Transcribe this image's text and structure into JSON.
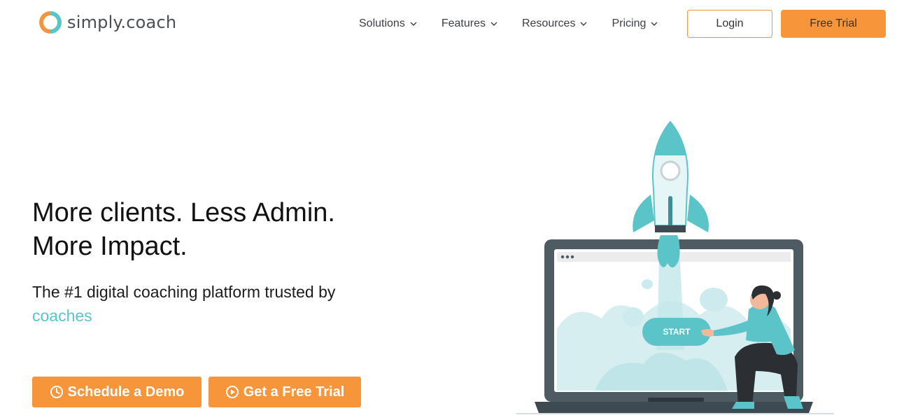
{
  "brand": {
    "name": "simply.coach",
    "accent": "#f7953b",
    "teal": "#5bc4c9",
    "logo_icon": "simply-coach-logo-icon"
  },
  "nav": {
    "items": [
      {
        "label": "Solutions",
        "icon": "chevron-down-icon"
      },
      {
        "label": "Features",
        "icon": "chevron-down-icon"
      },
      {
        "label": "Resources",
        "icon": "chevron-down-icon"
      },
      {
        "label": "Pricing",
        "icon": "chevron-down-icon"
      }
    ],
    "login_label": "Login",
    "trial_label": "Free Trial"
  },
  "hero": {
    "title_line1": "More clients. Less Admin.",
    "title_line2": "More Impact.",
    "subtitle": "The #1 digital coaching platform trusted by",
    "highlight": "coaches",
    "cta_demo": {
      "label": "Schedule a Demo",
      "icon": "clock-icon"
    },
    "cta_trial": {
      "label": "Get a Free Trial",
      "icon": "play-circle-icon"
    }
  },
  "illustration": {
    "button_label": "START",
    "description_icon": "rocket-launch-illustration"
  }
}
